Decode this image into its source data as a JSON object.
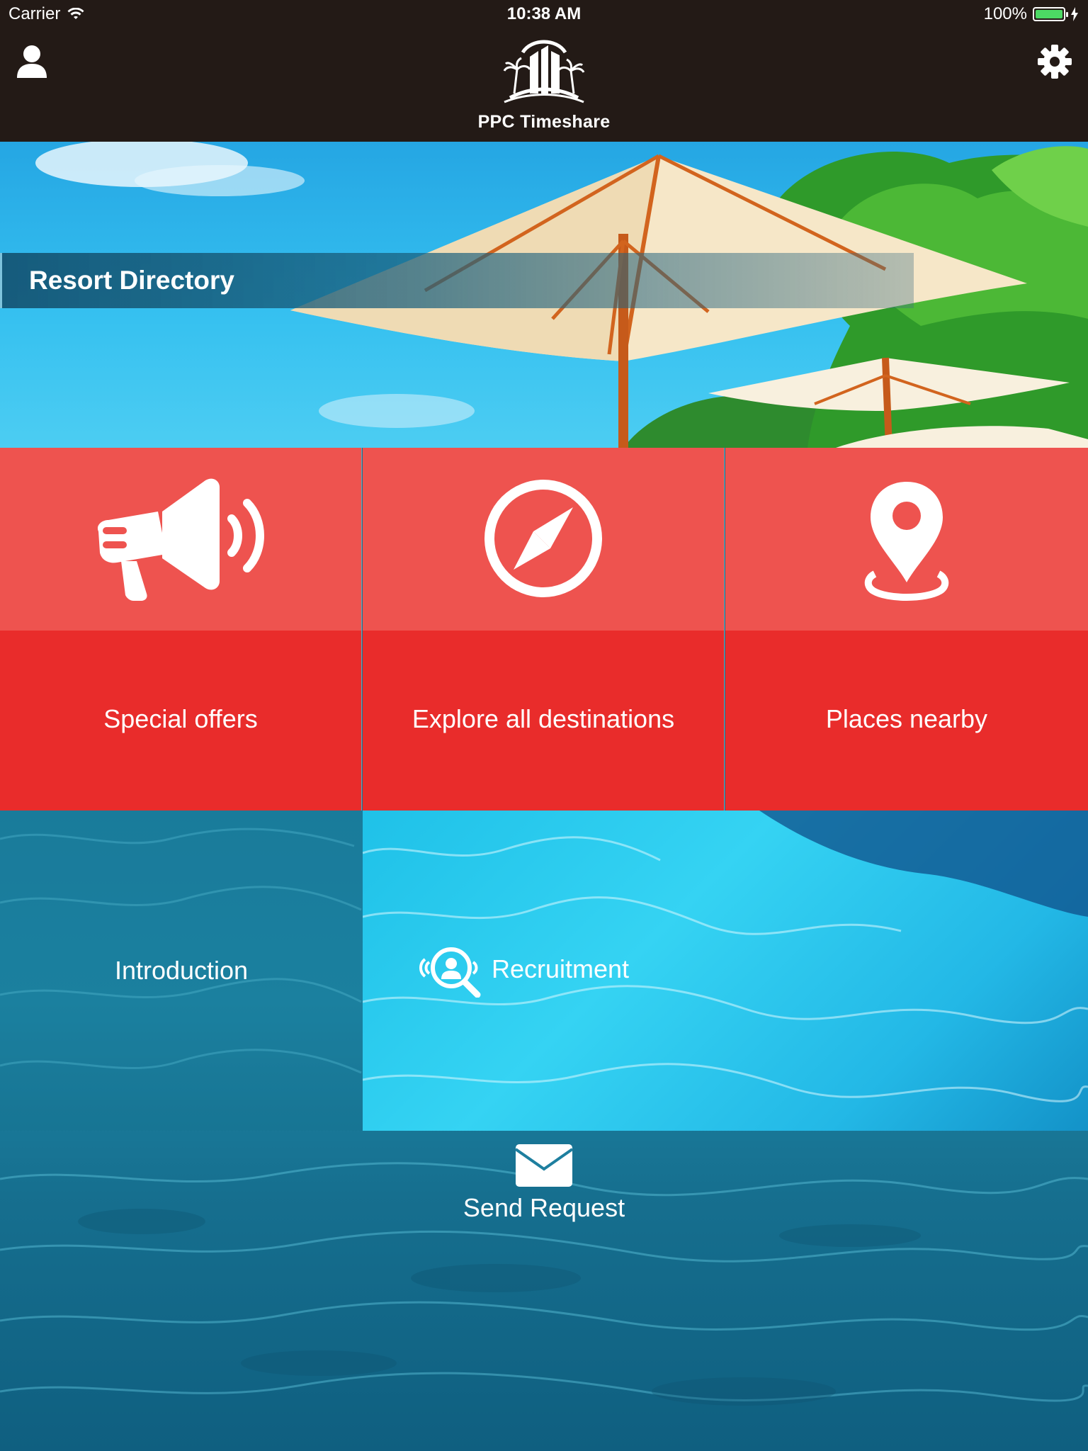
{
  "status_bar": {
    "carrier": "Carrier",
    "time": "10:38 AM",
    "battery": "100%"
  },
  "nav": {
    "brand": "PPC Timeshare",
    "left_icon": "user-icon",
    "right_icon": "gear-icon"
  },
  "hero": {
    "title": "Resort Directory"
  },
  "tiles": [
    {
      "label": "Special offers",
      "icon": "megaphone-icon"
    },
    {
      "label": "Explore all destinations",
      "icon": "compass-icon"
    },
    {
      "label": "Places nearby",
      "icon": "location-pin-icon"
    }
  ],
  "menu": {
    "introduction": "Introduction",
    "recruitment": "Recruitment",
    "send_request": "Send Request"
  },
  "colors": {
    "nav_bg": "#231a16",
    "tile_top": "#ee534f",
    "tile_bottom": "#e92c2b",
    "battery": "#4cd964"
  }
}
